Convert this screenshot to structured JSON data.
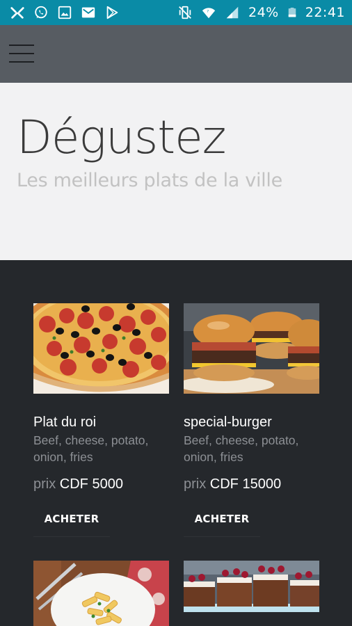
{
  "status_bar": {
    "battery": "24%",
    "time": "22:41"
  },
  "hero": {
    "title": "Dégustez",
    "subtitle": "Les meilleurs plats de la ville"
  },
  "products": [
    {
      "name": "Plat du roi",
      "description": "Beef, cheese, potato, onion, fries",
      "price_label": "prix",
      "price_value": "CDF 5000",
      "button": "ACHETER",
      "image": "pizza-image"
    },
    {
      "name": "special-burger",
      "description": "Beef, cheese, potato, onion, fries",
      "price_label": "prix",
      "price_value": "CDF 15000",
      "button": "ACHETER",
      "image": "burger-image"
    },
    {
      "image": "pasta-image"
    },
    {
      "image": "cake-image"
    }
  ],
  "colors": {
    "status_bar": "#0a8ba6",
    "app_bar": "#575c62",
    "hero_bg": "#f2f2f3",
    "content_bg": "#25282c"
  }
}
